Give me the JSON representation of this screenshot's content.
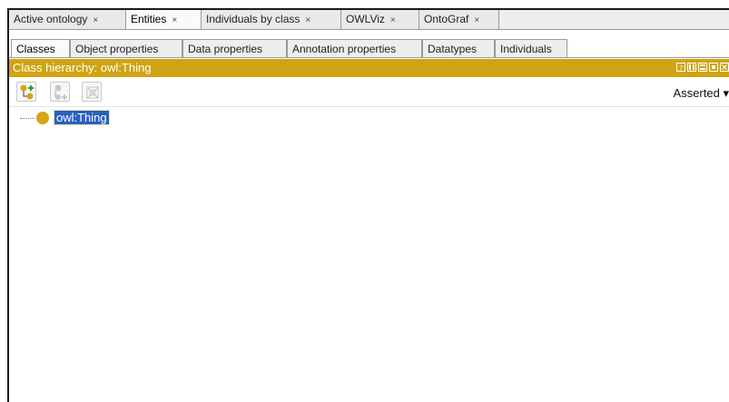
{
  "top_tabs": [
    {
      "label": "Active ontology",
      "close": "×",
      "active": false
    },
    {
      "label": "Entities",
      "close": "×",
      "active": true
    },
    {
      "label": "Individuals by class",
      "close": "×",
      "active": false
    },
    {
      "label": "OWLViz",
      "close": "×",
      "active": false
    },
    {
      "label": "OntoGraf",
      "close": "×",
      "active": false
    }
  ],
  "entity_tabs": [
    {
      "label": "Classes",
      "active": true
    },
    {
      "label": "Object properties",
      "active": false
    },
    {
      "label": "Data properties",
      "active": false
    },
    {
      "label": "Annotation properties",
      "active": false
    },
    {
      "label": "Datatypes",
      "active": false
    },
    {
      "label": "Individuals",
      "active": false
    }
  ],
  "panel": {
    "title": "Class hierarchy: owl:Thing",
    "view_mode": "Asserted",
    "view_mode_arrow": "▾",
    "header_buttons": [
      "help-icon",
      "split-vertical-icon",
      "split-horizontal-icon",
      "float-icon",
      "close-icon"
    ]
  },
  "toolbar": {
    "buttons": [
      "add-subclass-icon",
      "add-sibling-class-icon",
      "delete-class-icon"
    ]
  },
  "tree": {
    "root_label": "owl:Thing"
  },
  "colors": {
    "header_gold": "#cfa413",
    "class_dot": "#d4a514",
    "selection_blue": "#2a5fc1"
  }
}
